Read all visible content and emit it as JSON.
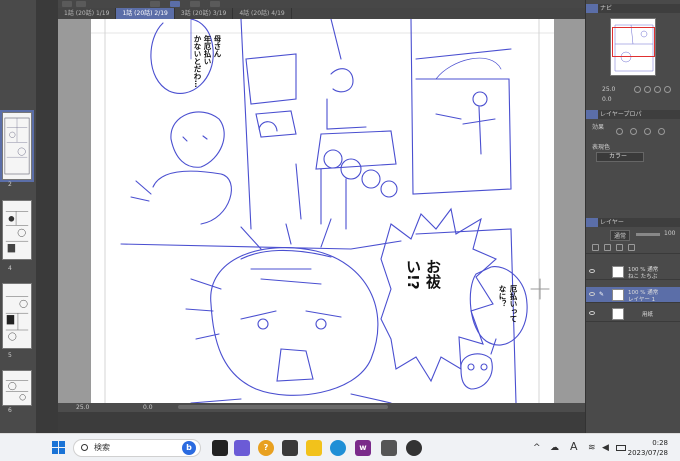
{
  "tabs": [
    {
      "label": "1話 (20話) 1/19"
    },
    {
      "label": "1話 (20話) 2/19",
      "active": true
    },
    {
      "label": "3話 (20話) 3/19"
    },
    {
      "label": "4話 (20話) 4/19"
    }
  ],
  "pages": {
    "numbers": [
      "2",
      "4",
      "5",
      "6"
    ]
  },
  "canvas": {
    "speech_top_left": [
      "母さん",
      "年厄払い",
      "かないとだわ…"
    ],
    "shout": [
      "お祓",
      "い!?"
    ],
    "speech_right": [
      "厄払いって",
      "なに？"
    ]
  },
  "status": {
    "zoom": "25.0",
    "angle": "0.0"
  },
  "navigator": {
    "header": "ナビ"
  },
  "layer_property": {
    "header": "レイヤープロパ",
    "effect_label": "効果",
    "expression_label": "表現色",
    "expression_value": "カラー"
  },
  "layers": {
    "header": "レイヤー",
    "blend_mode": "通常",
    "opacity": "100",
    "items": [
      {
        "line1": "100 % 通常",
        "line2": "ねこ たちぶ"
      },
      {
        "line1": "100 % 通常",
        "line2": "レイヤー 1",
        "selected": true
      },
      {
        "line1": "用紙",
        "line2": ""
      }
    ]
  },
  "taskbar": {
    "search_placeholder": "検索",
    "ime": "A",
    "time": "0:28",
    "date": "2023/07/28"
  }
}
